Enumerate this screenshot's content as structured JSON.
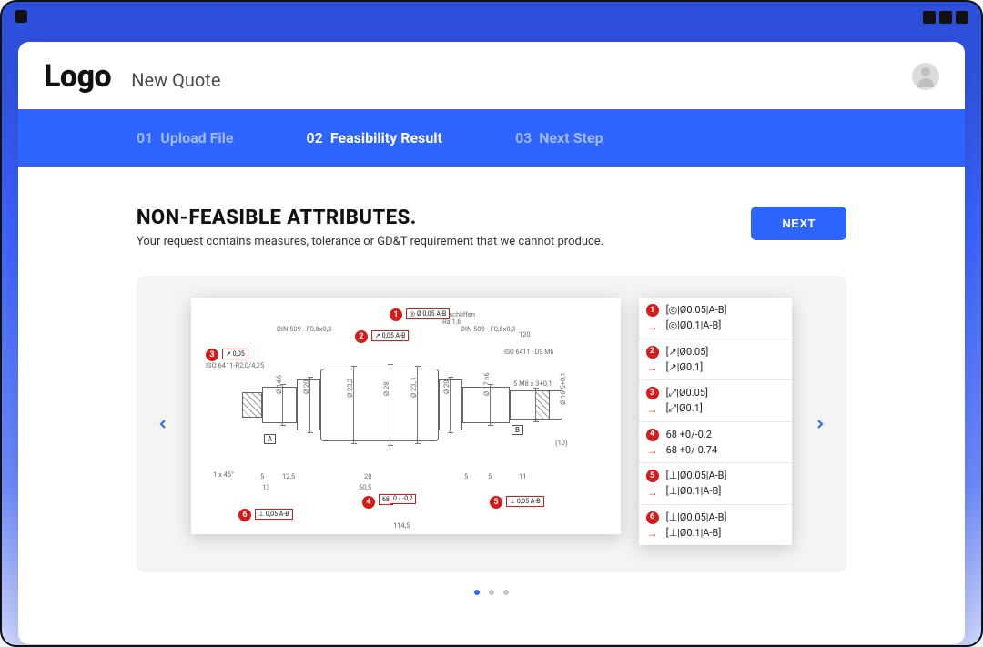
{
  "header": {
    "logo": "Logo",
    "page_title": "New Quote"
  },
  "steps": [
    {
      "num": "01",
      "label": "Upload File",
      "active": false
    },
    {
      "num": "02",
      "label": "Feasibility Result",
      "active": true
    },
    {
      "num": "03",
      "label": "Next Step",
      "active": false
    }
  ],
  "section": {
    "title": "NON-FEASIBLE ATTRIBUTES.",
    "subtitle": "Your request contains measures, tolerance or GD&T requirement that we cannot produce.",
    "next_label": "NEXT"
  },
  "drawing": {
    "callouts": {
      "din_left": "DIN 509 - F0,8x0,3",
      "din_right": "DIN 509 - F0,8x0,3",
      "finish_label": "geschliffen",
      "finish_ra": "Ra 1,6",
      "iso_left": "ISO 6411-R2,0/4,25",
      "iso_right": "ISO 6411 - DS M6",
      "thread": "5 M8 x 3+0,1",
      "chamfer": "1 x 45°"
    },
    "redboxes": {
      "r1": "◎ Ø 0,05 A-B",
      "r2": "↗ 0,05 A-B",
      "r3": "↗ 0,05",
      "r4a": "68",
      "r4b": "0 / -0,2",
      "r6": "⊥ 0,05 A-B",
      "r5": "⊥ 0,05 A-B"
    },
    "diams": {
      "d1": "Ø 14,6",
      "d2": "Ø 20",
      "d3": "Ø 23,2",
      "d4": "Ø 28",
      "d5": "Ø 23,.1",
      "d6": "Ø 20",
      "d7": "Ø 17 h6",
      "d8": "Ø 16-5+0,1"
    },
    "dims": {
      "a": "120",
      "b": "114,5",
      "c": "50,5",
      "d": "28",
      "e": "13",
      "f": "12,5",
      "g": "5",
      "h": "5",
      "i": "5",
      "j": "11",
      "k": "(10)"
    },
    "datums": {
      "A": "A",
      "B": "B"
    },
    "pins": {
      "1": "1",
      "2": "2",
      "3": "3",
      "4": "4",
      "5": "5",
      "6": "6"
    }
  },
  "legend": [
    {
      "pin": "1",
      "from": "[◎|Ø0.05|A-B]",
      "to": "[◎|Ø0.1|A-B]"
    },
    {
      "pin": "2",
      "from": "[↗|Ø0.05]",
      "to": "[↗|Ø0.1]"
    },
    {
      "pin": "3",
      "from": "[⤢|Ø0.05]",
      "to": "[⤢|Ø0.1]"
    },
    {
      "pin": "4",
      "from": "68 +0/-0.2",
      "to": "68 +0/-0.74"
    },
    {
      "pin": "5",
      "from": "[⊥|Ø0.05|A-B]",
      "to": "[⊥|Ø0.1|A-B]"
    },
    {
      "pin": "6",
      "from": "[⊥|Ø0.05|A-B]",
      "to": "[⊥|Ø0.1|A-B]"
    }
  ],
  "carousel": {
    "page": 1,
    "total": 3
  }
}
